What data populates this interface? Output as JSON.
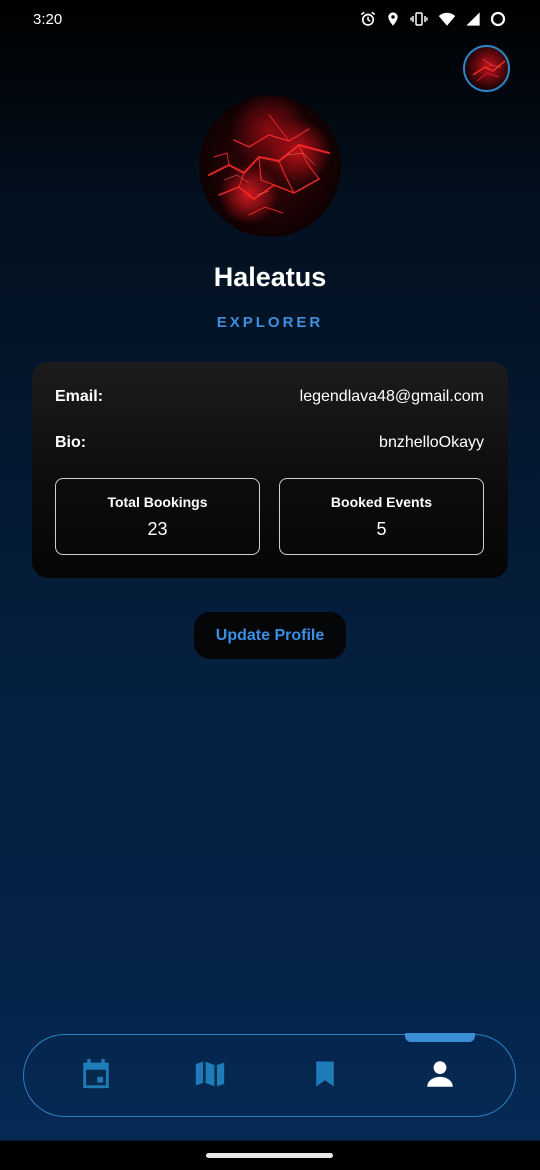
{
  "status_bar": {
    "time": "3:20",
    "icons": [
      "alarm-icon",
      "location-icon",
      "vibrate-icon",
      "wifi-icon",
      "signal-icon",
      "battery-icon"
    ]
  },
  "profile": {
    "name": "Haleatus",
    "role": "EXPLORER"
  },
  "details": {
    "email_label": "Email:",
    "email_value": "legendlava48@gmail.com",
    "bio_label": "Bio:",
    "bio_value": "bnzhelloOkayy"
  },
  "stats": {
    "total_bookings_label": "Total Bookings",
    "total_bookings_value": "23",
    "booked_events_label": "Booked Events",
    "booked_events_value": "5"
  },
  "actions": {
    "update_profile_label": "Update Profile"
  },
  "bottom_nav": {
    "items": [
      "calendar-icon",
      "map-icon",
      "bookmark-icon",
      "person-icon"
    ],
    "active": "person-icon"
  },
  "colors": {
    "accent": "#3b8fe6",
    "nav_icon": "#1e7db8",
    "role_text": "#3f8fe0"
  }
}
